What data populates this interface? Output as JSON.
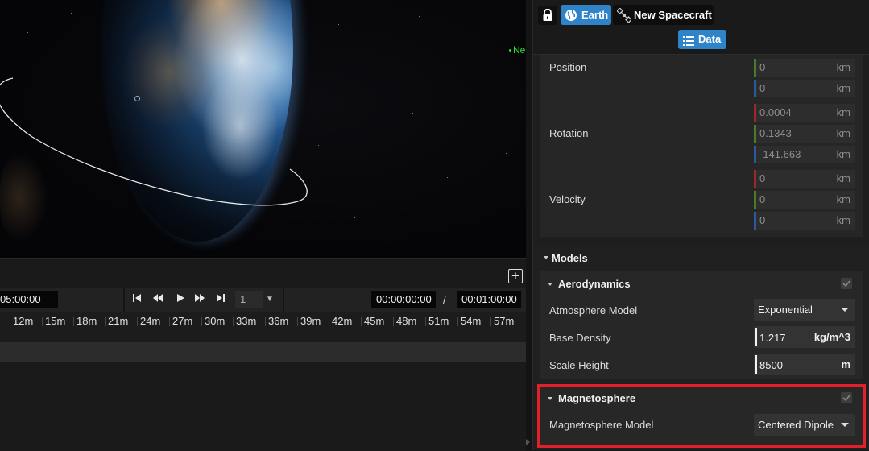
{
  "viewport": {
    "object_label": "Ne"
  },
  "timeline": {
    "current_time": "05:00:00",
    "speed": "1",
    "start_time": "00:00:00:00",
    "separator": "/",
    "end_time": "00:01:00:00",
    "ticks": [
      "12m",
      "15m",
      "18m",
      "21m",
      "24m",
      "27m",
      "30m",
      "33m",
      "36m",
      "39m",
      "42m",
      "45m",
      "48m",
      "51m",
      "54m",
      "57m"
    ],
    "add_icon": "plus-square-icon",
    "buttons": [
      "skip-to-start-icon",
      "rewind-icon",
      "play-icon",
      "fast-forward-icon",
      "skip-to-end-icon"
    ]
  },
  "header": {
    "lock_icon": "lock-icon",
    "earth_tab": "Earth",
    "spacecraft_tab": "New Spacecraft",
    "data_button": "Data"
  },
  "properties": {
    "position_label": "Position",
    "position": [
      {
        "value": "0",
        "unit": "km",
        "axis_color": "#4a7a2a"
      },
      {
        "value": "0",
        "unit": "km",
        "axis_color": "#2a5aa0"
      }
    ],
    "rotation_label": "Rotation",
    "rotation": [
      {
        "value": "0.0004",
        "unit": "km",
        "axis_color": "#9a2a2a"
      },
      {
        "value": "0.1343",
        "unit": "km",
        "axis_color": "#4a7a2a"
      },
      {
        "value": "-141.663",
        "unit": "km",
        "axis_color": "#2a5aa0"
      }
    ],
    "velocity_label": "Velocity",
    "velocity": [
      {
        "value": "0",
        "unit": "km",
        "axis_color": "#9a2a2a"
      },
      {
        "value": "0",
        "unit": "km",
        "axis_color": "#4a7a2a"
      },
      {
        "value": "0",
        "unit": "km",
        "axis_color": "#2a5aa0"
      }
    ]
  },
  "models": {
    "title": "Models",
    "aerodynamics": {
      "title": "Aerodynamics",
      "enabled": true,
      "atmosphere_model_label": "Atmosphere Model",
      "atmosphere_model_value": "Exponential",
      "base_density_label": "Base Density",
      "base_density_value": "1.217",
      "base_density_unit": "kg/m^3",
      "scale_height_label": "Scale Height",
      "scale_height_value": "8500",
      "scale_height_unit": "m"
    },
    "magnetosphere": {
      "title": "Magnetosphere",
      "enabled": true,
      "model_label": "Magnetosphere Model",
      "model_value": "Centered Dipole",
      "highlight_color": "#e0202a"
    }
  },
  "colors": {
    "accent": "#2f83c8",
    "label_green": "#2ee02e"
  }
}
